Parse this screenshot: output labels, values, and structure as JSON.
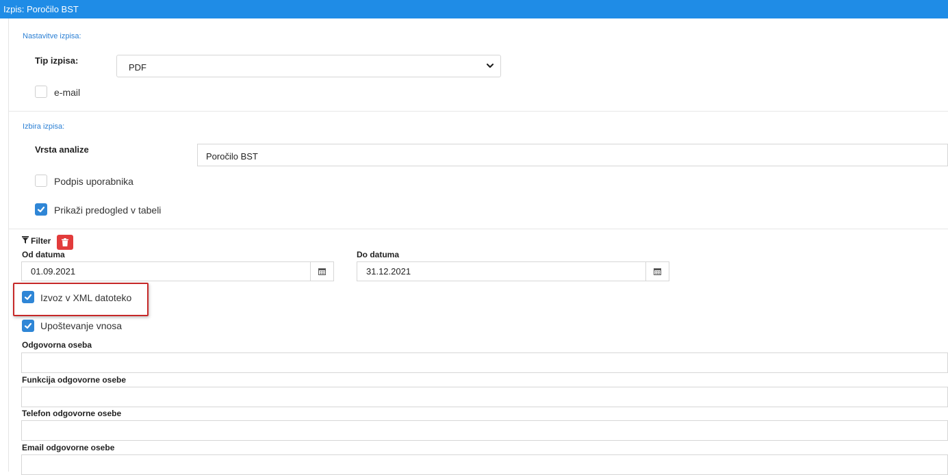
{
  "window": {
    "title": "Izpis: Poročilo BST"
  },
  "settings": {
    "section_title": "Nastavitve izpisa:",
    "type_label": "Tip izpisa:",
    "type_value": "PDF",
    "email_label": "e-mail",
    "email_checked": false
  },
  "selection": {
    "section_title": "Izbira izpisa:",
    "analysis_label": "Vrsta analize",
    "analysis_value": "Poročilo BST",
    "user_signature_label": "Podpis uporabnika",
    "user_signature_checked": false,
    "preview_label": "Prikaži predogled v tabeli",
    "preview_checked": true
  },
  "filter": {
    "title": "Filter",
    "from_label": "Od datuma",
    "from_value": "01.09.2021",
    "to_label": "Do datuma",
    "to_value": "31.12.2021",
    "xml_export_label": "Izvoz v XML datoteko",
    "xml_export_checked": true,
    "consider_input_label": "Upoštevanje vnosa",
    "consider_input_checked": true,
    "responsible_person_label": "Odgovorna oseba",
    "responsible_person_value": "",
    "responsible_function_label": "Funkcija odgovorne osebe",
    "responsible_function_value": "",
    "responsible_phone_label": "Telefon odgovorne osebe",
    "responsible_phone_value": "",
    "responsible_email_label": "Email odgovorne osebe",
    "responsible_email_value": ""
  },
  "colors": {
    "titlebar": "#1f8ce6",
    "section_title": "#2a7fd4",
    "checkbox_checked": "#2f86d6",
    "delete_button": "#e23b3b",
    "highlight_border": "#c62828"
  }
}
